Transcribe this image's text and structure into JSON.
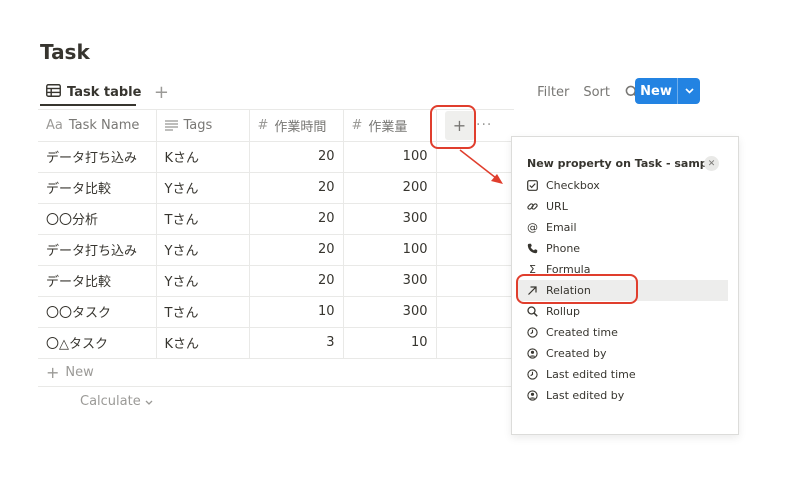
{
  "page": {
    "title": "Task"
  },
  "view": {
    "tab_label": "Task table"
  },
  "toolbar": {
    "filter_label": "Filter",
    "sort_label": "Sort",
    "new_label": "New"
  },
  "table": {
    "headers": {
      "name": "Task Name",
      "name_prefix": "Aa",
      "tags": "Tags",
      "time": "作業時間",
      "amount": "作業量"
    },
    "rows": [
      {
        "name": "データ打ち込み",
        "tags": "Kさん",
        "time": "20",
        "amount": "100"
      },
      {
        "name": "データ比較",
        "tags": "Yさん",
        "time": "20",
        "amount": "200"
      },
      {
        "name": "〇〇分析",
        "tags": "Tさん",
        "time": "20",
        "amount": "300"
      },
      {
        "name": "データ打ち込み",
        "tags": "Yさん",
        "time": "20",
        "amount": "100"
      },
      {
        "name": "データ比較",
        "tags": "Yさん",
        "time": "20",
        "amount": "300"
      },
      {
        "name": "〇〇タスク",
        "tags": "Tさん",
        "time": "10",
        "amount": "300"
      },
      {
        "name": "〇△タスク",
        "tags": "Kさん",
        "time": "3",
        "amount": "10"
      }
    ],
    "new_row_label": "New",
    "calculate_label": "Calculate"
  },
  "popup": {
    "title": "New property on Task - sample",
    "items": [
      {
        "label": "Checkbox",
        "icon": "checkbox-icon"
      },
      {
        "label": "URL",
        "icon": "link-icon"
      },
      {
        "label": "Email",
        "icon": "at-icon"
      },
      {
        "label": "Phone",
        "icon": "phone-icon"
      },
      {
        "label": "Formula",
        "icon": "sigma-icon"
      },
      {
        "label": "Relation",
        "icon": "arrow-up-right-icon"
      },
      {
        "label": "Rollup",
        "icon": "magnifier-icon"
      },
      {
        "label": "Created time",
        "icon": "clock-icon"
      },
      {
        "label": "Created by",
        "icon": "person-icon"
      },
      {
        "label": "Last edited time",
        "icon": "clock-icon"
      },
      {
        "label": "Last edited by",
        "icon": "person-icon"
      }
    ]
  },
  "colors": {
    "accent": "#2383e2",
    "annotation": "#e03e2d",
    "text": "#37352f",
    "muted": "#787774"
  }
}
